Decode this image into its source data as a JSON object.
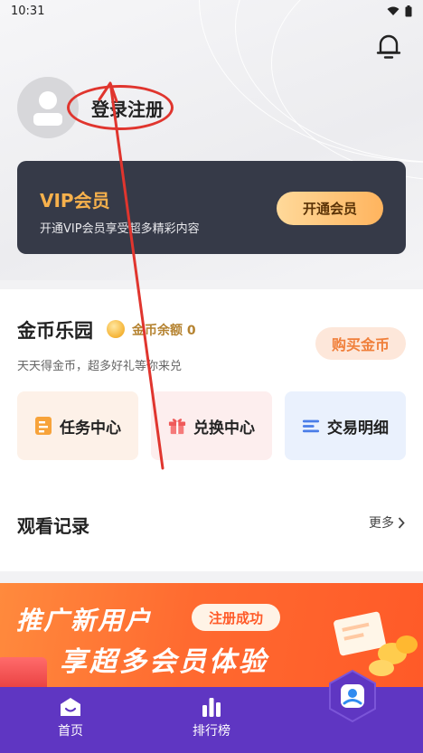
{
  "status_bar": {
    "time": "10:31"
  },
  "profile": {
    "login_label": "登录注册"
  },
  "vip": {
    "title": "VIP会员",
    "subtitle": "开通VIP会员享受超多精彩内容",
    "button": "开通会员"
  },
  "coins": {
    "title": "金币乐园",
    "balance": "金币余额 0",
    "buy_button": "购买金币",
    "subtitle": "天天得金币，超多好礼等你来兑",
    "tiles": [
      {
        "label": "任务中心",
        "icon": "task-icon"
      },
      {
        "label": "兑换中心",
        "icon": "gift-icon"
      },
      {
        "label": "交易明细",
        "icon": "list-icon"
      }
    ]
  },
  "history": {
    "title": "观看记录",
    "more": "更多"
  },
  "banner": {
    "line1": "推广新用户",
    "badge": "注册成功",
    "line2": "享超多会员体验"
  },
  "nav": {
    "items": [
      {
        "label": "首页",
        "icon": "home-icon"
      },
      {
        "label": "排行榜",
        "icon": "bar-chart-icon"
      },
      {
        "label": "",
        "icon": "profile-icon"
      }
    ]
  },
  "colors": {
    "vip_card": "#363a48",
    "vip_gold": "#f7b14c",
    "nav_purple": "#5f36c2",
    "annotation_red": "#e0352e",
    "banner_orange": "#ff6a30"
  }
}
